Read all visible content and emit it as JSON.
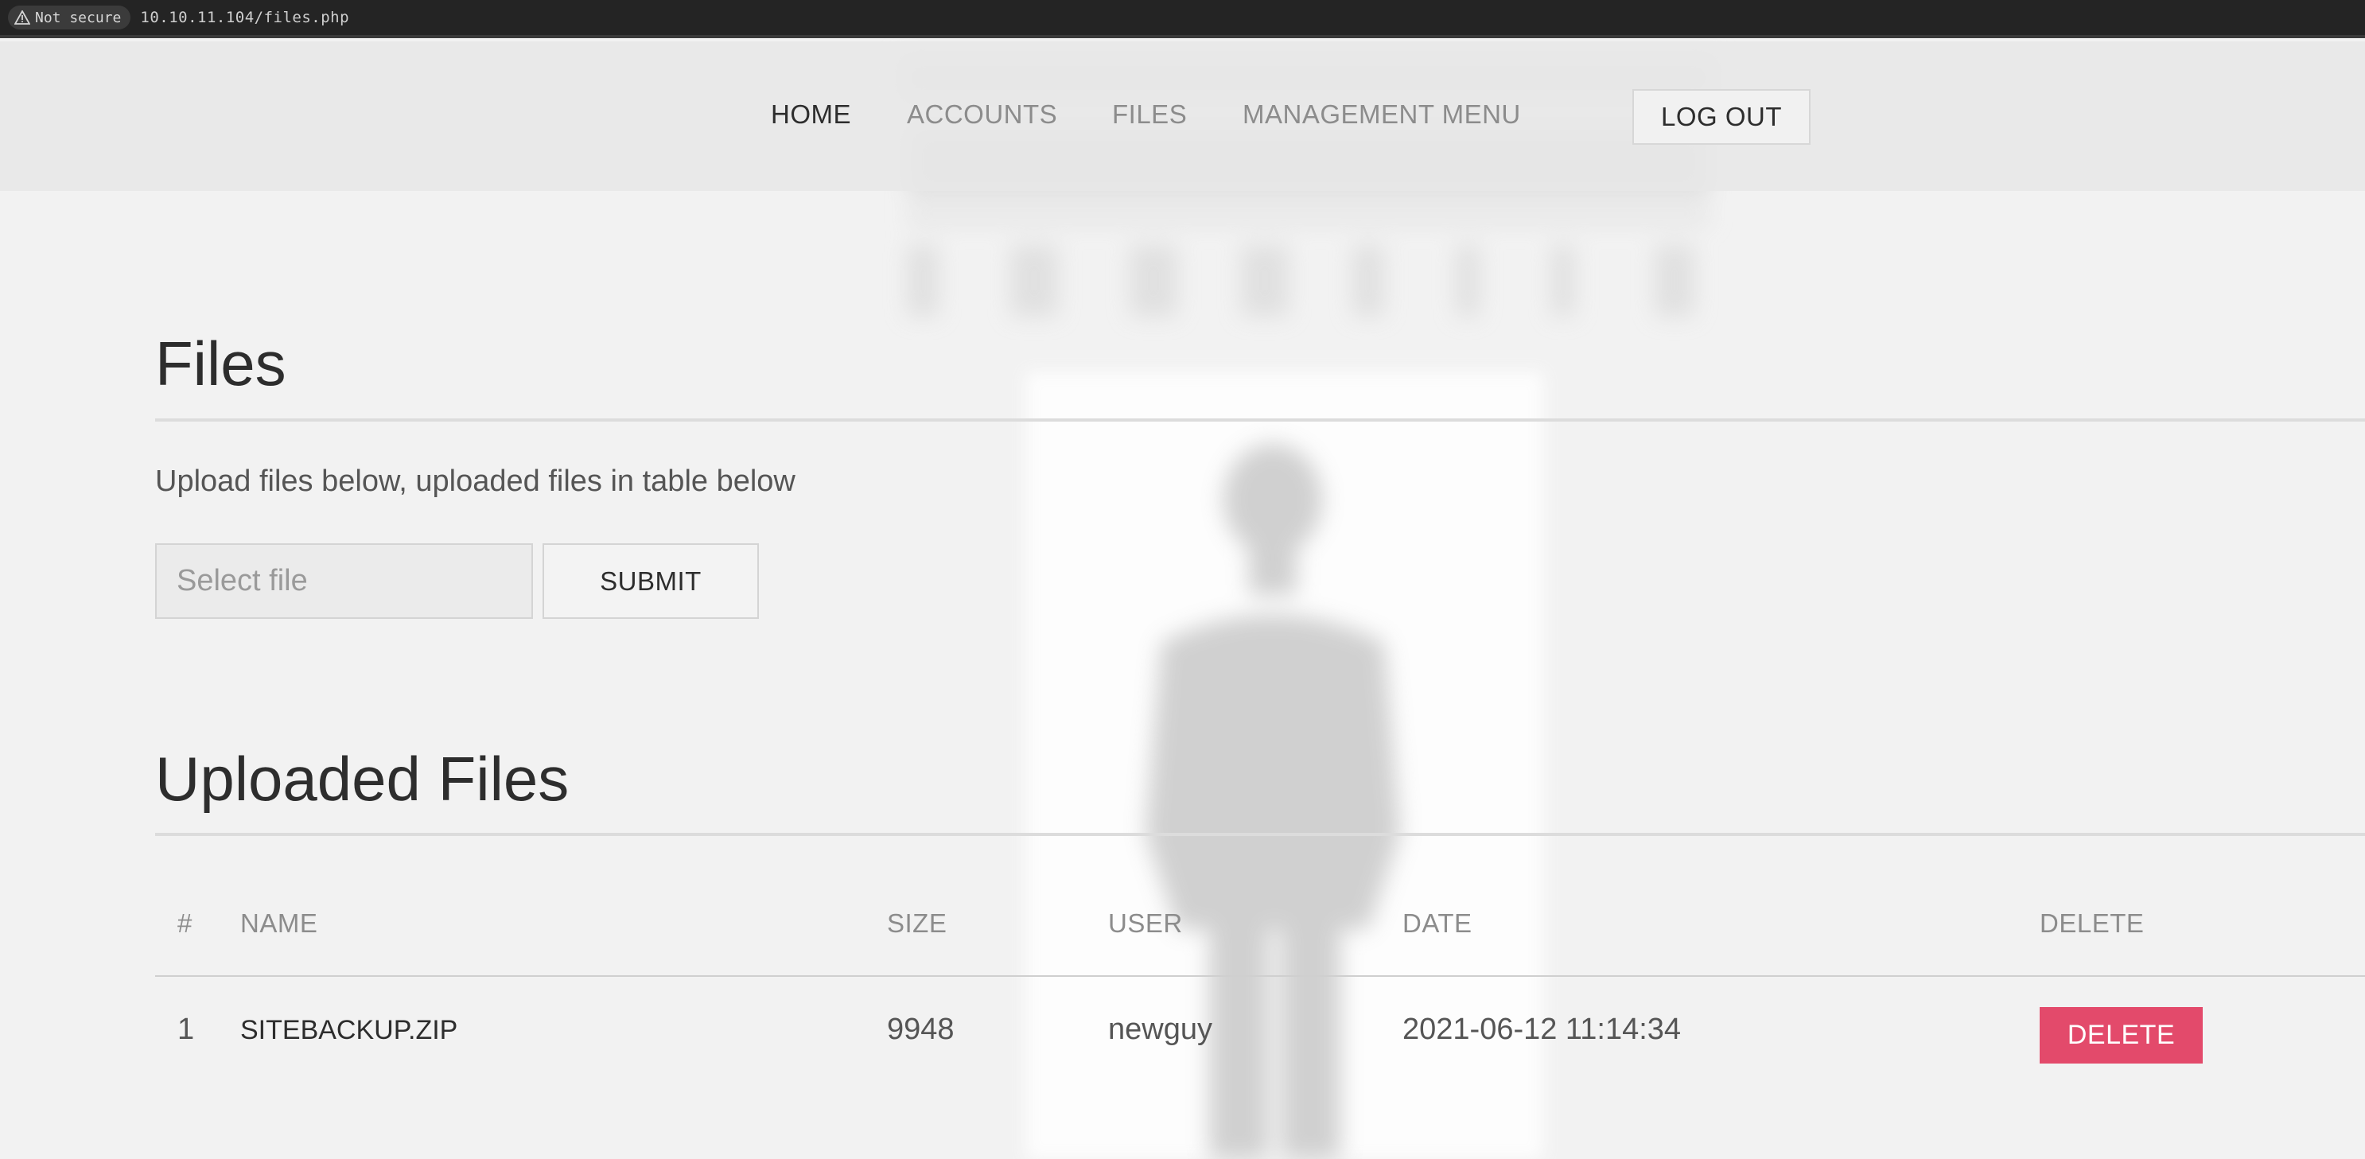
{
  "browser": {
    "security_label": "Not secure",
    "url": "10.10.11.104/files.php"
  },
  "nav": {
    "items": [
      {
        "label": "HOME",
        "active": true
      },
      {
        "label": "ACCOUNTS",
        "active": false
      },
      {
        "label": "FILES",
        "active": false
      },
      {
        "label": "MANAGEMENT MENU",
        "active": false
      }
    ],
    "logout_label": "LOG OUT"
  },
  "files_section": {
    "title": "Files",
    "subtitle": "Upload files below, uploaded files in table below",
    "file_placeholder": "Select file",
    "submit_label": "SUBMIT"
  },
  "uploaded_section": {
    "title": "Uploaded Files",
    "columns": [
      "#",
      "NAME",
      "SIZE",
      "USER",
      "DATE",
      "DELETE"
    ],
    "rows": [
      {
        "num": "1",
        "name": "SITEBACKUP.ZIP",
        "size": "9948",
        "user": "newguy",
        "date": "2021-06-12 11:14:34",
        "delete_label": "DELETE"
      }
    ]
  },
  "colors": {
    "delete_button": "#e34a6b",
    "page_background": "#f2f2f2"
  }
}
